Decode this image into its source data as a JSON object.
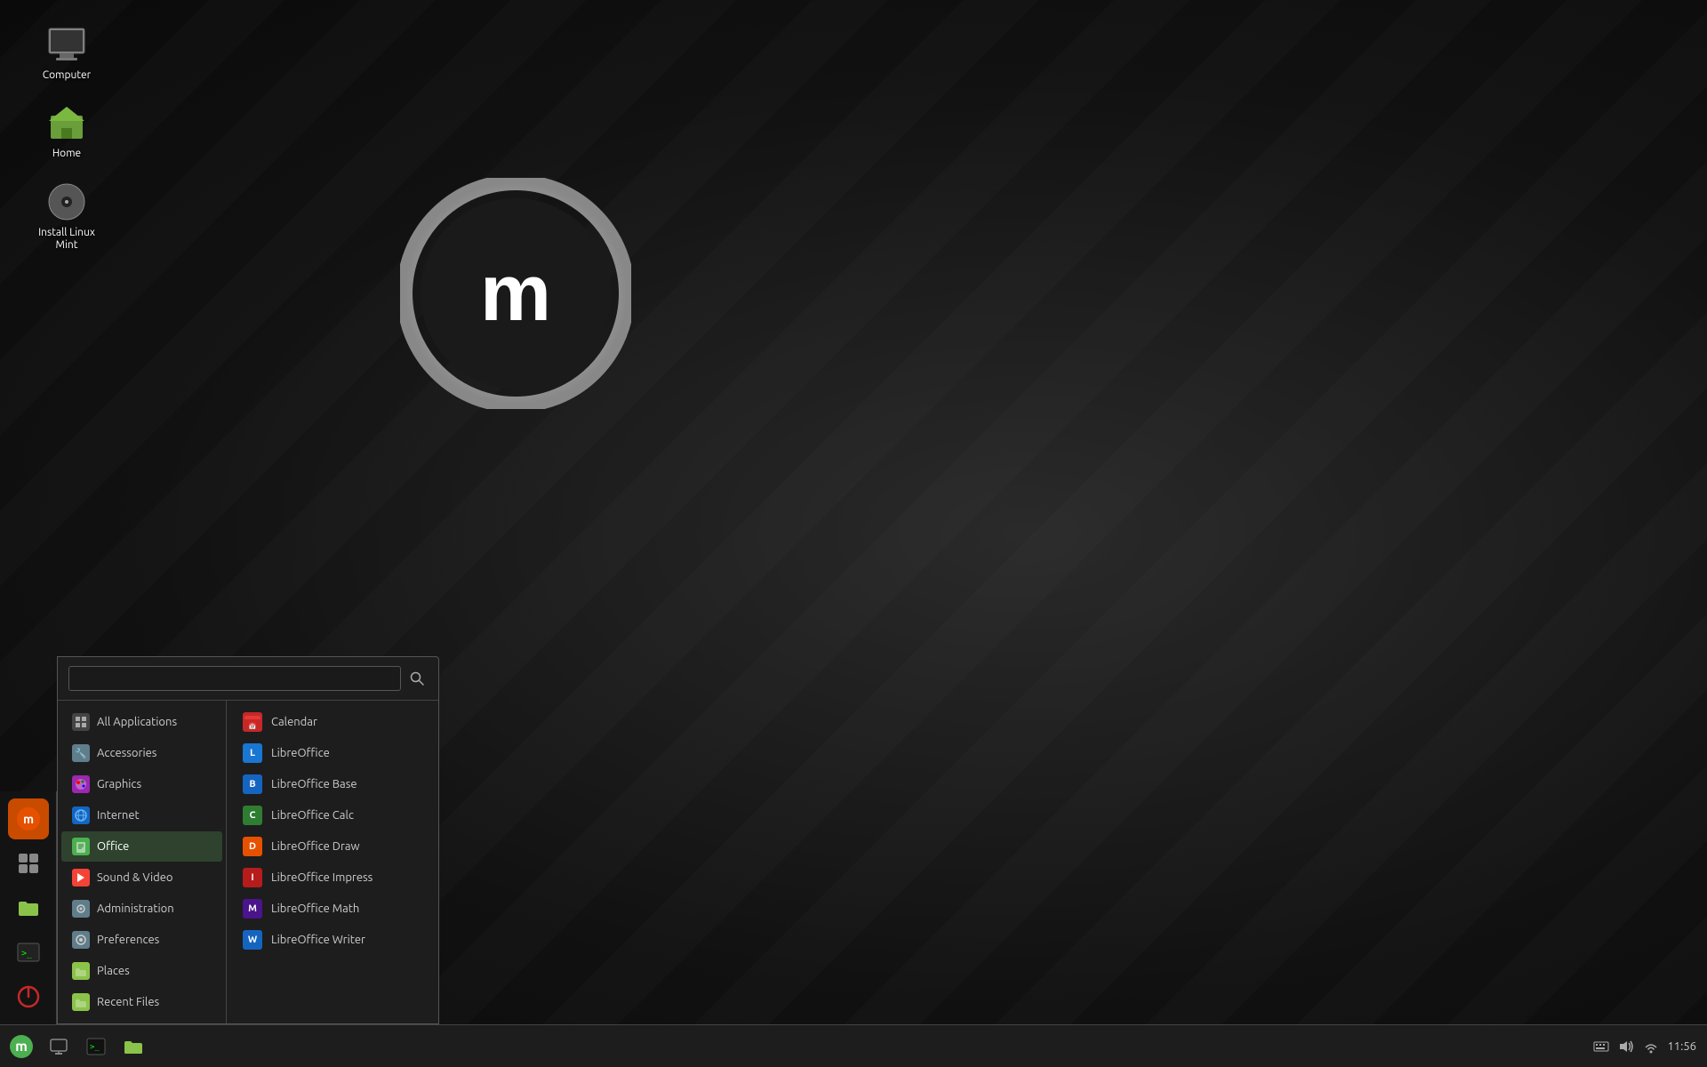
{
  "desktop": {
    "icons": [
      {
        "id": "computer",
        "label": "Computer",
        "type": "computer"
      },
      {
        "id": "home",
        "label": "Home",
        "type": "folder-home"
      },
      {
        "id": "install",
        "label": "Install Linux Mint",
        "type": "dvd"
      }
    ]
  },
  "taskbar": {
    "left_buttons": [
      {
        "id": "mintmenu",
        "icon": "🌿",
        "label": "Menu"
      },
      {
        "id": "show-desktop",
        "icon": "🖥",
        "label": "Show Desktop"
      },
      {
        "id": "terminal",
        "icon": "⬛",
        "label": "Terminal"
      },
      {
        "id": "files",
        "icon": "📁",
        "label": "Files"
      }
    ],
    "clock": "11:56",
    "tray_icons": [
      "🔊",
      "📶",
      "⌨"
    ]
  },
  "menu": {
    "search": {
      "placeholder": "",
      "value": ""
    },
    "left_panel_icons": [
      {
        "id": "mintmenu-icon",
        "icon": "🌿",
        "color": "#e65100"
      },
      {
        "id": "apps-icon",
        "icon": "⬛",
        "color": "#555"
      },
      {
        "id": "files-icon",
        "icon": "📁",
        "color": "#2e7d32"
      },
      {
        "id": "terminal-icon",
        "icon": ">_",
        "color": "#333"
      },
      {
        "id": "power-icon",
        "icon": "⏻",
        "color": "#c62828"
      }
    ],
    "categories": [
      {
        "id": "all",
        "label": "All  Applications",
        "icon": "⬛",
        "icon_color": "#555",
        "active": false
      },
      {
        "id": "accessories",
        "label": "Accessories",
        "icon": "🔧",
        "icon_color": "#607d8b",
        "active": false
      },
      {
        "id": "graphics",
        "label": "Graphics",
        "icon": "🎨",
        "icon_color": "#9c27b0",
        "active": false
      },
      {
        "id": "internet",
        "label": "Internet",
        "icon": "🌐",
        "icon_color": "#1565c0",
        "active": false
      },
      {
        "id": "office",
        "label": "Office",
        "icon": "📄",
        "icon_color": "#4caf50",
        "active": true
      },
      {
        "id": "sound-video",
        "label": "Sound & Video",
        "icon": "▶",
        "icon_color": "#f44336",
        "active": false
      },
      {
        "id": "administration",
        "label": "Administration",
        "icon": "⚙",
        "icon_color": "#607d8b",
        "active": false
      },
      {
        "id": "preferences",
        "label": "Preferences",
        "icon": "🔧",
        "icon_color": "#607d8b",
        "active": false
      },
      {
        "id": "places",
        "label": "Places",
        "icon": "📁",
        "icon_color": "#8bc34a",
        "active": false
      },
      {
        "id": "recent",
        "label": "Recent Files",
        "icon": "🕐",
        "icon_color": "#8bc34a",
        "active": false
      }
    ],
    "apps": [
      {
        "id": "calendar",
        "label": "Calendar",
        "icon_class": "lo-calendar",
        "icon_text": "📅"
      },
      {
        "id": "libreoffice",
        "label": "LibreOffice",
        "icon_class": "lo-main",
        "icon_text": "L"
      },
      {
        "id": "libreoffice-base",
        "label": "LibreOffice Base",
        "icon_class": "lo-base",
        "icon_text": "B"
      },
      {
        "id": "libreoffice-calc",
        "label": "LibreOffice Calc",
        "icon_class": "lo-calc",
        "icon_text": "C"
      },
      {
        "id": "libreoffice-draw",
        "label": "LibreOffice Draw",
        "icon_class": "lo-draw",
        "icon_text": "D"
      },
      {
        "id": "libreoffice-impress",
        "label": "LibreOffice Impress",
        "icon_class": "lo-impress",
        "icon_text": "I"
      },
      {
        "id": "libreoffice-math",
        "label": "LibreOffice Math",
        "icon_class": "lo-math",
        "icon_text": "M"
      },
      {
        "id": "libreoffice-writer",
        "label": "LibreOffice Writer",
        "icon_class": "lo-writer",
        "icon_text": "W"
      }
    ]
  }
}
